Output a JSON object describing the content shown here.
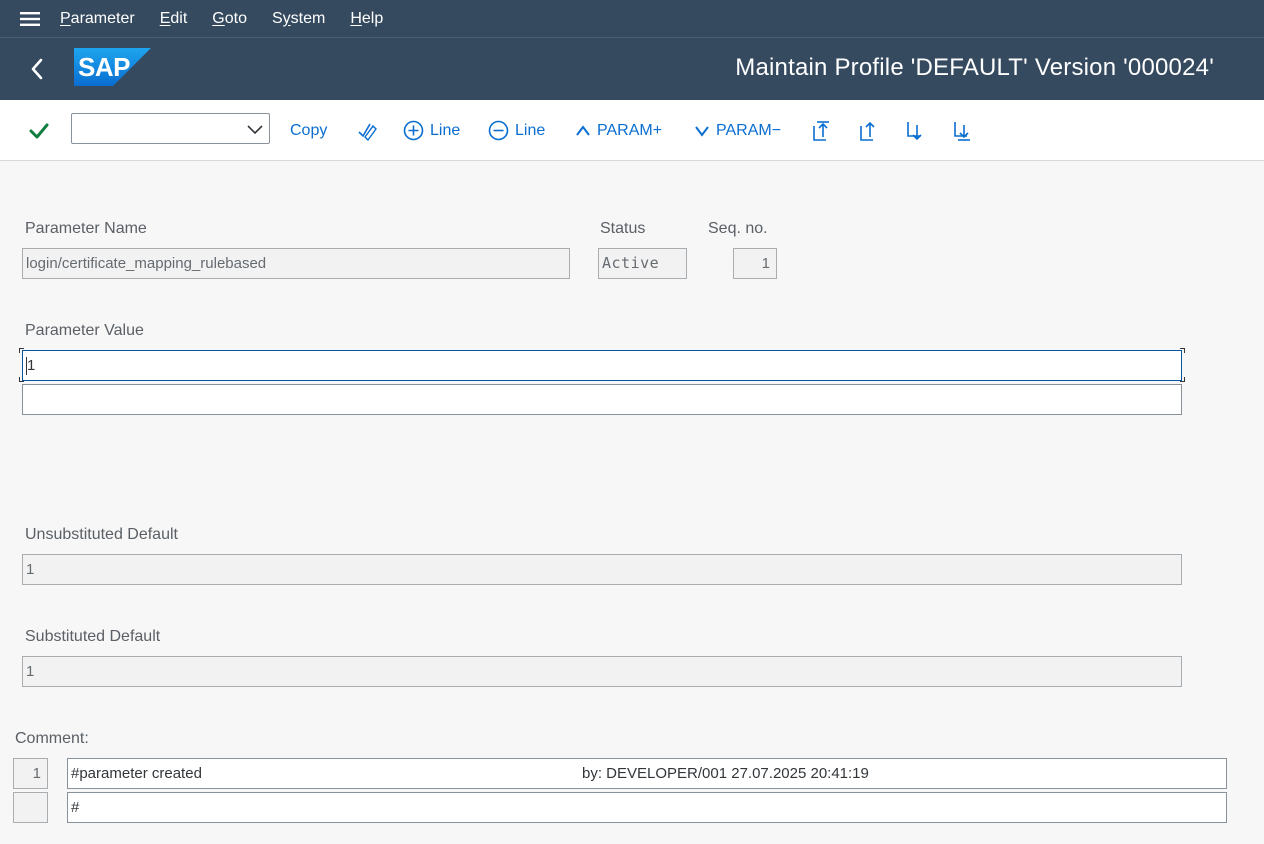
{
  "menubar": {
    "items": [
      {
        "label": "Parameter",
        "mnemonic": "P",
        "rest": "arameter"
      },
      {
        "label": "Edit",
        "mnemonic": "E",
        "rest": "dit"
      },
      {
        "label": "Goto",
        "mnemonic": "G",
        "rest": "oto"
      },
      {
        "label": "System",
        "pre": "S",
        "mnemonic": "y",
        "rest": "stem"
      },
      {
        "label": "Help",
        "mnemonic": "H",
        "rest": "elp"
      }
    ]
  },
  "header": {
    "logo_text": "SAP",
    "title": "Maintain Profile 'DEFAULT' Version '000024'"
  },
  "toolbar": {
    "command_value": "",
    "copy_label": "Copy",
    "add_line_label": "Line",
    "remove_line_label": "Line",
    "param_up_label": "PARAM+",
    "param_down_label": "PARAM−"
  },
  "form": {
    "param_name_label": "Parameter Name",
    "param_name_value": "login/certificate_mapping_rulebased",
    "status_label": "Status",
    "status_value": "Active",
    "seq_label": "Seq. no.",
    "seq_value": "1",
    "param_value_label": "Parameter Value",
    "param_value_line1": "1",
    "param_value_line2": "",
    "unsub_label": "Unsubstituted Default",
    "unsub_value": "1",
    "sub_label": "Substituted Default",
    "sub_value": "1"
  },
  "comment": {
    "label": "Comment:",
    "rows": [
      {
        "num": "1",
        "text": "#parameter created",
        "by": "by: DEVELOPER/001 27.07.2025 20:41:19"
      },
      {
        "num": "",
        "text": "#",
        "by": ""
      }
    ]
  },
  "colors": {
    "shell": "#354a5f",
    "accent": "#0a6ed1",
    "check": "#107e3e",
    "logo": "#1b90e0"
  }
}
